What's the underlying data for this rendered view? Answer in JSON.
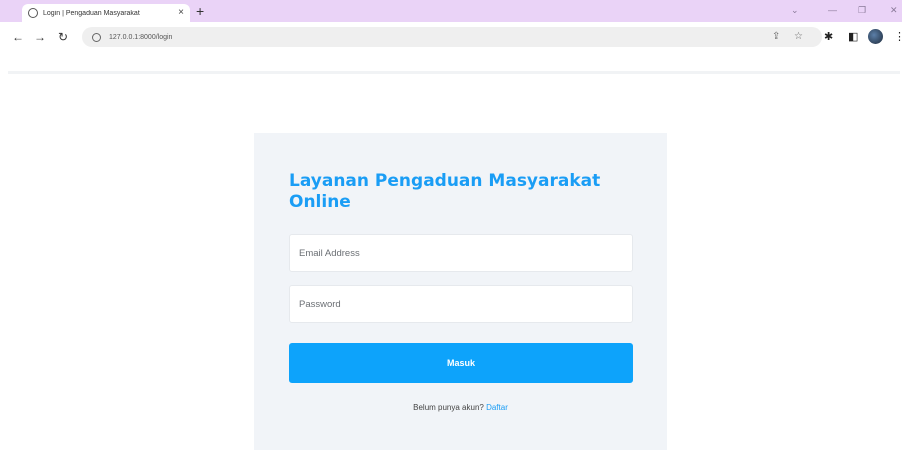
{
  "browser": {
    "tab": {
      "title": "Login | Pengaduan Masyarakat",
      "close": "×",
      "favicon": "globe-icon"
    },
    "new_tab": "+",
    "window_controls": [
      "⌄",
      "—",
      "❐",
      "✕"
    ],
    "nav": {
      "back": "←",
      "forward": "→",
      "reload": "↻"
    },
    "url": "127.0.0.1:8000/login",
    "omnibox_icons": {
      "share": "⇪",
      "star": "☆"
    },
    "toolbar_icons": {
      "extensions": "✱",
      "sidebar": "◧",
      "menu": "⋮"
    }
  },
  "login": {
    "title": "Layanan Pengaduan Masyarakat Online",
    "email_placeholder": "Email Address",
    "password_placeholder": "Password",
    "submit_label": "Masuk",
    "register_prompt": "Belum punya akun?",
    "register_link": "Daftar"
  },
  "colors": {
    "accent": "#0da3fb",
    "title": "#1a9df5",
    "card_bg": "#f1f4f8",
    "tabstrip_bg": "#ead3f7"
  }
}
